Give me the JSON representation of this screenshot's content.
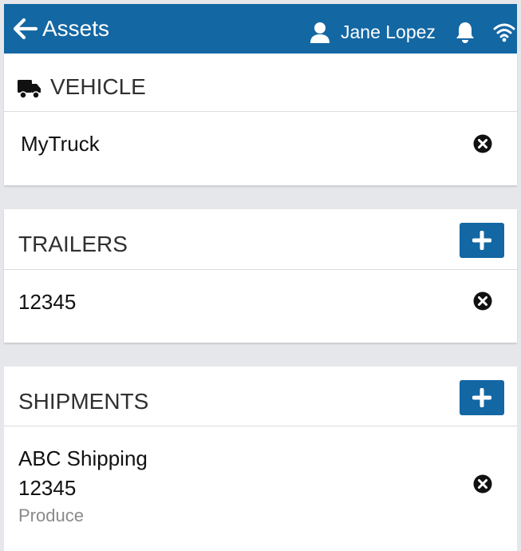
{
  "header": {
    "back_icon": "arrow-left-icon",
    "title": "Assets",
    "user_icon": "user-icon",
    "user_name": "Jane Lopez",
    "bell_icon": "bell-icon",
    "wifi_icon": "wifi-icon",
    "color": "#1367a3"
  },
  "vehicle": {
    "icon": "truck-icon",
    "title": "VEHICLE",
    "items": [
      {
        "name": "MyTruck",
        "remove_icon": "remove-circle-icon"
      }
    ]
  },
  "trailers": {
    "title": "TRAILERS",
    "add_icon": "plus-icon",
    "items": [
      {
        "name": "12345",
        "remove_icon": "remove-circle-icon"
      }
    ]
  },
  "shipments": {
    "title": "SHIPMENTS",
    "add_icon": "plus-icon",
    "items": [
      {
        "name": "ABC Shipping",
        "number": "12345",
        "type": "Produce",
        "remove_icon": "remove-circle-icon"
      }
    ]
  }
}
